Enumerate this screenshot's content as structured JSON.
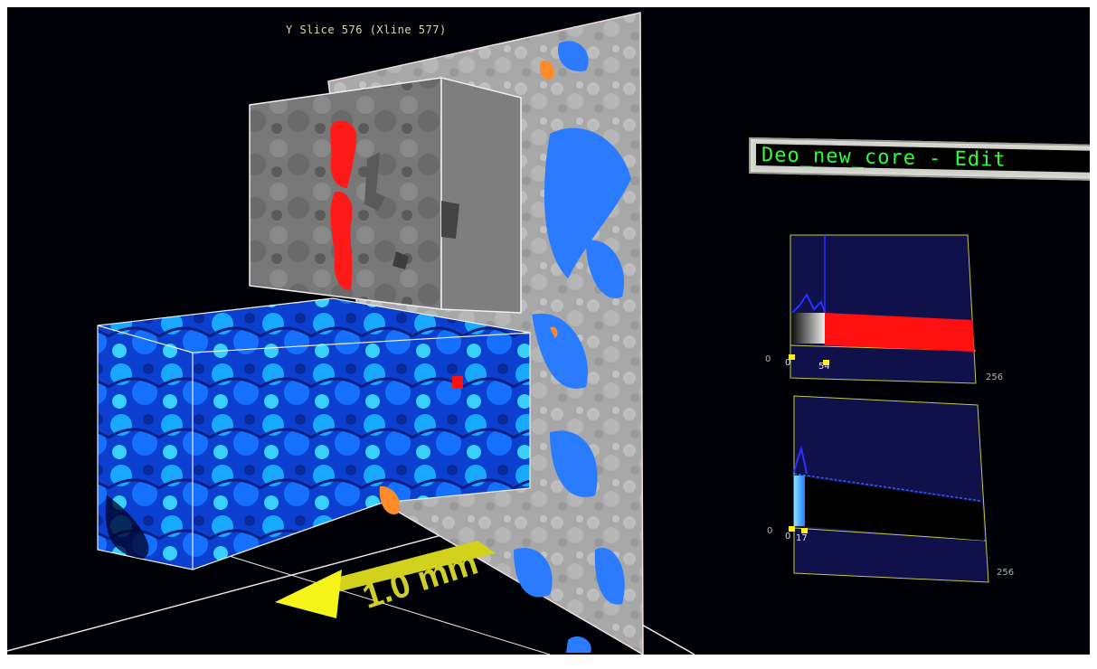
{
  "slice_label": "Y Slice 576 (Xline 577)",
  "module_title": "Deo_new_core - Edit",
  "scale_bar": {
    "label": "1.0 mm",
    "color": "#d2d21c"
  },
  "transfer_function_1": {
    "min_label": "0",
    "left_marker": "0",
    "right_marker": "54",
    "max_label": "256",
    "ramp_color": "#ff1010"
  },
  "transfer_function_2": {
    "min_label": "0",
    "left_marker": "0",
    "right_marker": "17",
    "max_label": "256",
    "ramp_color": "#1f9fff"
  },
  "colors": {
    "background": "#000007",
    "frame": "#f0e8e8",
    "tf_panel": "#10104a",
    "tf_border": "#c8c840",
    "pore_blue": "#2b7bff",
    "pore_orange": "#ff8a2a",
    "title_text": "#2aff3a"
  },
  "icons": {
    "scale_arrow": "yellow-arrow-icon"
  }
}
